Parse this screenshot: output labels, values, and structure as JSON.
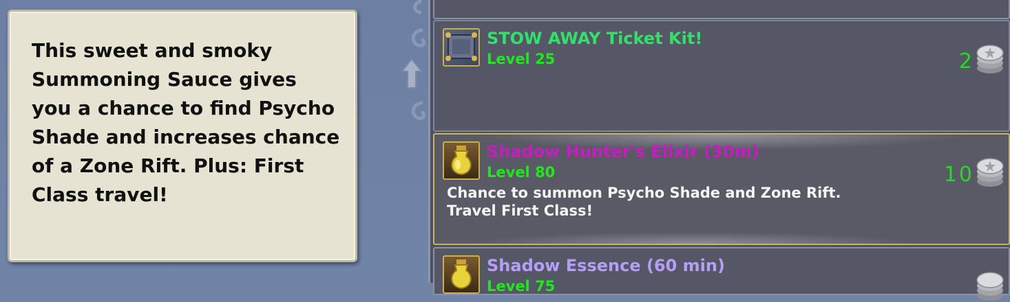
{
  "tooltip": {
    "text": "This sweet and smoky Summoning Sauce gives you a chance to find Psycho Shade and increases chance of a Zone Rift. Plus: First Class travel!"
  },
  "items": [
    {
      "name": "STOW AWAY Ticket Kit!",
      "name_color": "#33e06a",
      "level": "Level 25",
      "description": "",
      "price": "2",
      "icon": "ticket-kit-icon"
    },
    {
      "name": "Shadow Hunter's Elixir (30m)",
      "name_color": "#c21fbf",
      "level": "Level 80",
      "description": "Chance to summon Psycho Shade and Zone Rift. Travel First Class!",
      "price": "10",
      "icon": "elixir-potion-icon"
    },
    {
      "name": "Shadow Essence (60 min)",
      "name_color": "#b59ff5",
      "level": "Level 75",
      "description": "",
      "price": "",
      "icon": "essence-potion-icon"
    }
  ],
  "colors": {
    "level": "#22e61f",
    "price": "#1fdd1f",
    "selected_border": "#c8b84f"
  }
}
